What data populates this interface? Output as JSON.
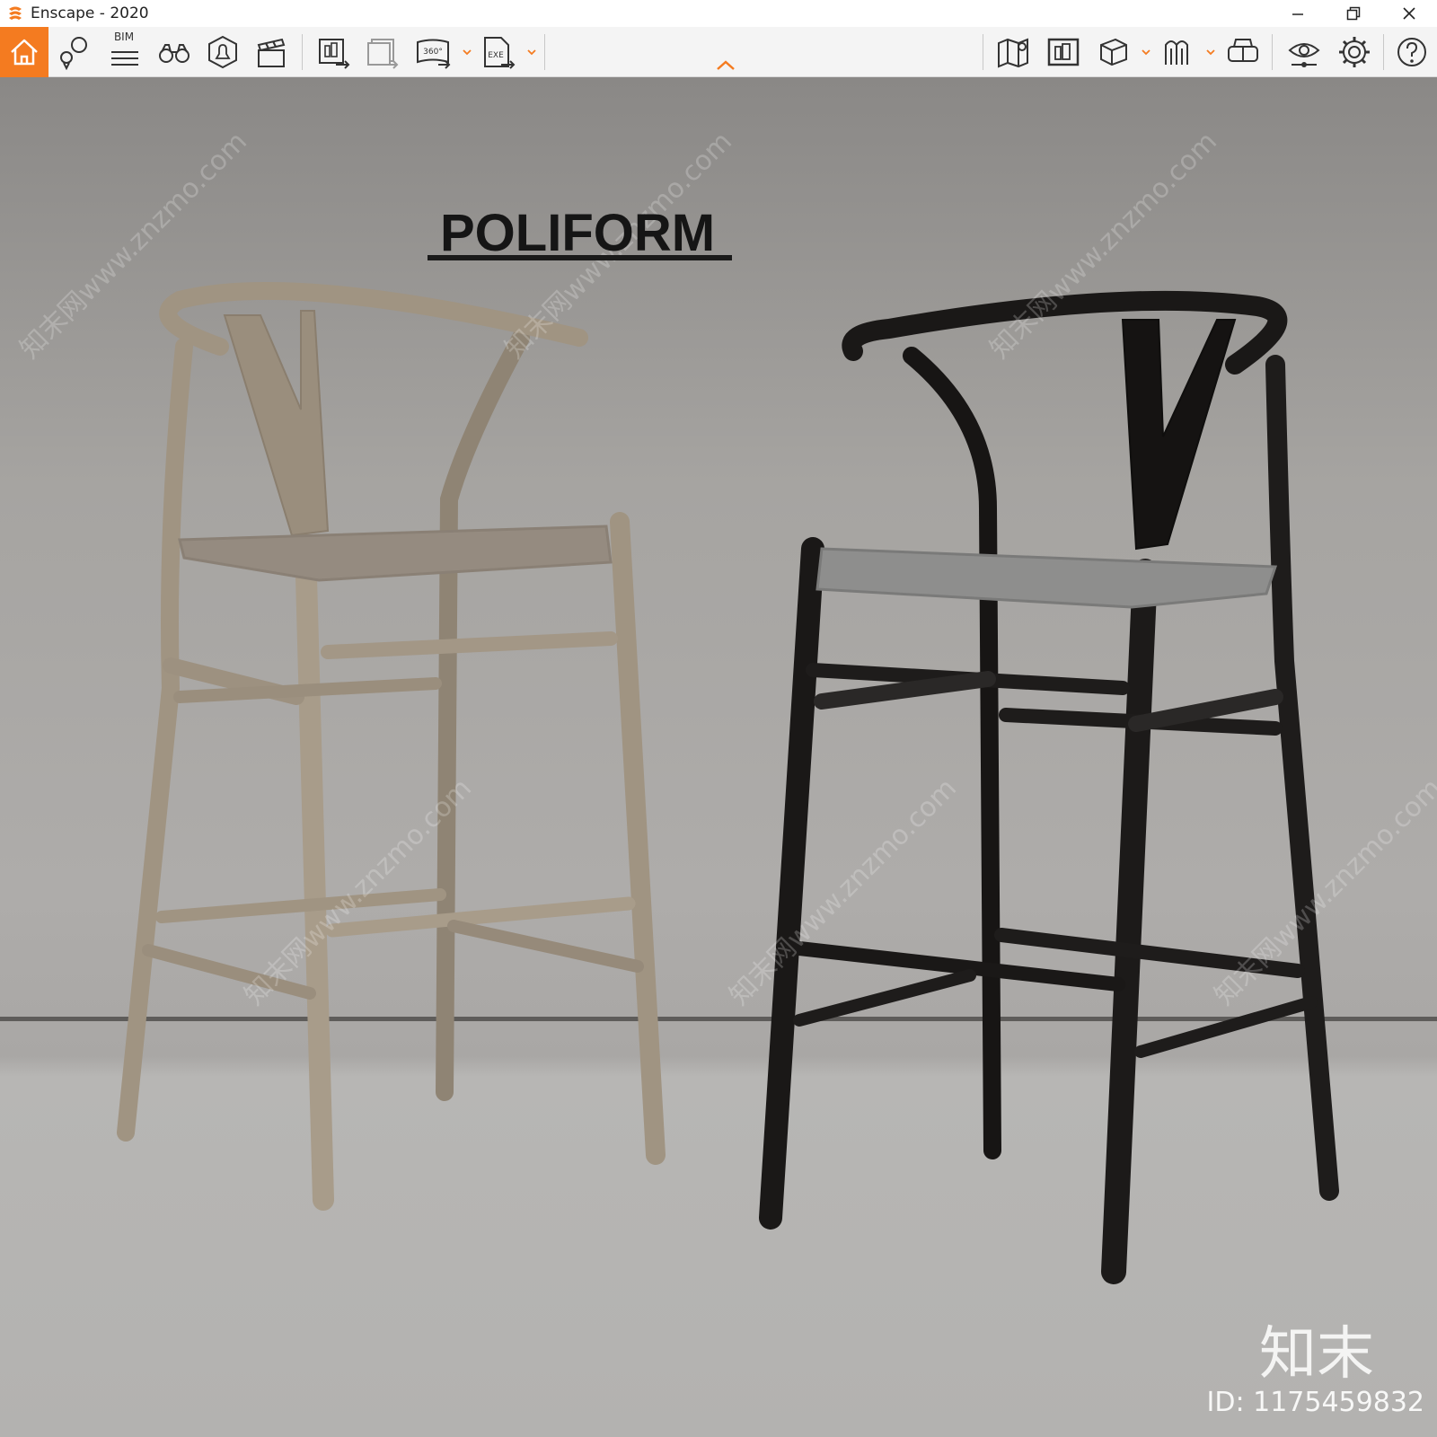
{
  "window": {
    "title": "Enscape - 2020",
    "controls": [
      "minimize",
      "restore",
      "close"
    ]
  },
  "toolbar": {
    "home": {
      "icon": "home-icon",
      "color": "#f47b20"
    },
    "bim_label": "BIM",
    "left_tools": [
      "map-pin-icon",
      "bim-list-icon",
      "binoculars-icon",
      "bell-icon",
      "clapperboard-icon",
      "export-image-icon",
      "batch-render-icon",
      "panorama-360-icon",
      "export-exe-icon"
    ],
    "right_tools": [
      "map-icon",
      "asset-library-icon",
      "cube-icon",
      "sun-icon",
      "vr-headset-icon",
      "visual-settings-icon",
      "settings-gear-icon",
      "help-icon"
    ],
    "labels": {
      "panorama": "360°",
      "exe": "EXE"
    }
  },
  "render": {
    "brand": "POLIFORM",
    "watermark_logo": "知末",
    "watermark_id": "ID: 1175459832",
    "watermark_repeat": "知末网www.znzmo.com",
    "chairs": [
      {
        "name": "oak-wishbone-bar-stool",
        "color": "#9b8f7f"
      },
      {
        "name": "black-wishbone-bar-stool",
        "color": "#1c1a19"
      }
    ]
  }
}
